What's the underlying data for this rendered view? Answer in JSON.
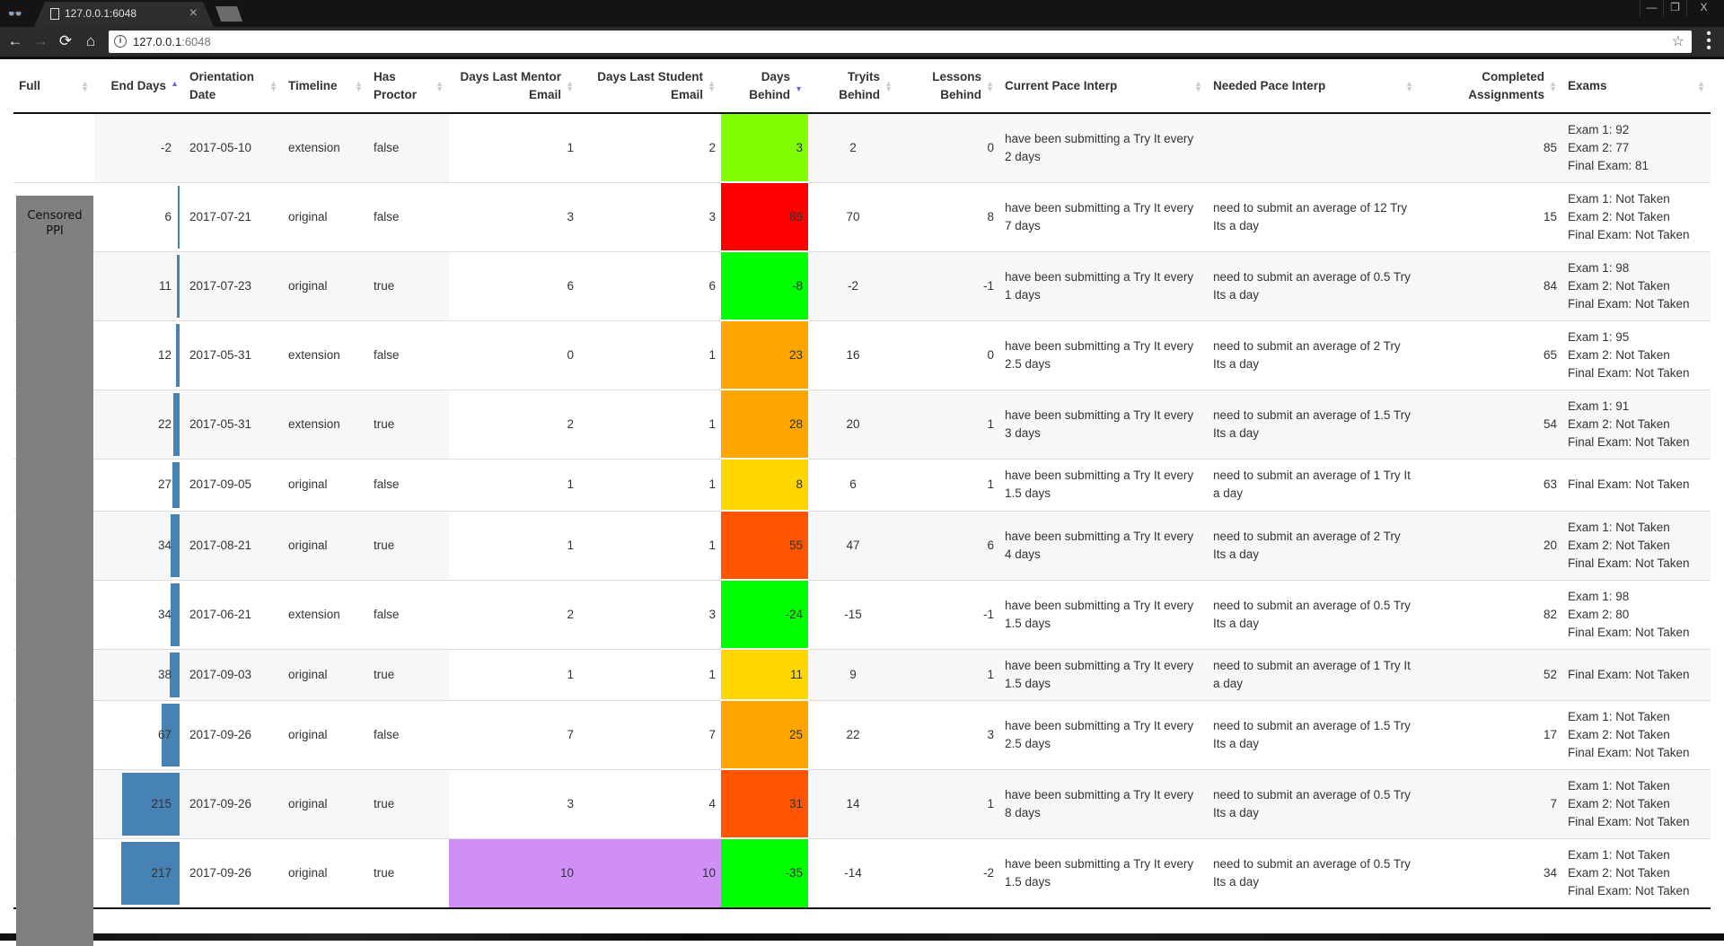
{
  "browser": {
    "tab_title": "127.0.0.1:6048",
    "url_host": "127.0.0.1",
    "url_port": ":6048",
    "icons": {
      "incognito": "incognito-icon",
      "page": "page-icon",
      "close": "×",
      "back": "←",
      "forward": "→",
      "reload": "⟳",
      "home": "⌂",
      "info": "i",
      "star": "☆",
      "menu": "⋮",
      "minimize": "—",
      "restore": "❐",
      "window_close": "X"
    }
  },
  "table": {
    "censored_label": "Censored PPI",
    "columns": [
      {
        "key": "full",
        "label": "Full",
        "sort": "none"
      },
      {
        "key": "end_days",
        "label": "End Days",
        "sort": "asc"
      },
      {
        "key": "orientation_date",
        "label": "Orientation Date",
        "sort": "none"
      },
      {
        "key": "timeline",
        "label": "Timeline",
        "sort": "none"
      },
      {
        "key": "has_proctor",
        "label": "Has Proctor",
        "sort": "none"
      },
      {
        "key": "days_last_mentor_email",
        "label": "Days Last Mentor Email",
        "sort": "none"
      },
      {
        "key": "days_last_student_email",
        "label": "Days Last Student Email",
        "sort": "none"
      },
      {
        "key": "days_behind",
        "label": "Days Behind",
        "sort": "desc"
      },
      {
        "key": "tryits_behind",
        "label": "Tryits Behind",
        "sort": "none"
      },
      {
        "key": "lessons_behind",
        "label": "Lessons Behind",
        "sort": "none"
      },
      {
        "key": "current_pace",
        "label": "Current Pace Interp",
        "sort": "none"
      },
      {
        "key": "needed_pace",
        "label": "Needed Pace Interp",
        "sort": "none"
      },
      {
        "key": "completed",
        "label": "Completed Assignments",
        "sort": "none"
      },
      {
        "key": "exams",
        "label": "Exams",
        "sort": "none"
      }
    ],
    "end_days_max": 217,
    "rows": [
      {
        "end_days": "-2",
        "orientation_date": "2017-05-10",
        "timeline": "extension",
        "has_proctor": "false",
        "mentor": "1",
        "student": "2",
        "days_behind": "3",
        "days_behind_color": "#80ff00",
        "tryits": "2",
        "lessons": "0",
        "current_pace": "have been submitting a Try It every 2 days",
        "needed_pace": "",
        "completed": "85",
        "exams": [
          "Exam 1: 92",
          "Exam 2: 77",
          "Final Exam: 81"
        ],
        "email_highlight": false
      },
      {
        "end_days": "6",
        "orientation_date": "2017-07-21",
        "timeline": "original",
        "has_proctor": "false",
        "mentor": "3",
        "student": "3",
        "days_behind": "89",
        "days_behind_color": "#ff0000",
        "tryits": "70",
        "lessons": "8",
        "current_pace": "have been submitting a Try It every 7 days",
        "needed_pace": "need to submit an average of 12 Try Its a day",
        "completed": "15",
        "exams": [
          "Exam 1: Not Taken",
          "Exam 2: Not Taken",
          "Final Exam: Not Taken"
        ],
        "email_highlight": false
      },
      {
        "end_days": "11",
        "orientation_date": "2017-07-23",
        "timeline": "original",
        "has_proctor": "true",
        "mentor": "6",
        "student": "6",
        "days_behind": "-8",
        "days_behind_color": "#00ff00",
        "tryits": "-2",
        "lessons": "-1",
        "current_pace": "have been submitting a Try It every 1 days",
        "needed_pace": "need to submit an average of 0.5 Try Its a day",
        "completed": "84",
        "exams": [
          "Exam 1: 98",
          "Exam 2: Not Taken",
          "Final Exam: Not Taken"
        ],
        "email_highlight": false
      },
      {
        "end_days": "12",
        "orientation_date": "2017-05-31",
        "timeline": "extension",
        "has_proctor": "false",
        "mentor": "0",
        "student": "1",
        "days_behind": "23",
        "days_behind_color": "#ffa500",
        "tryits": "16",
        "lessons": "0",
        "current_pace": "have been submitting a Try It every 2.5 days",
        "needed_pace": "need to submit an average of 2 Try Its a day",
        "completed": "65",
        "exams": [
          "Exam 1: 95",
          "Exam 2: Not Taken",
          "Final Exam: Not Taken"
        ],
        "email_highlight": false
      },
      {
        "end_days": "22",
        "orientation_date": "2017-05-31",
        "timeline": "extension",
        "has_proctor": "true",
        "mentor": "2",
        "student": "1",
        "days_behind": "28",
        "days_behind_color": "#ffa500",
        "tryits": "20",
        "lessons": "1",
        "current_pace": "have been submitting a Try It every 3 days",
        "needed_pace": "need to submit an average of 1.5 Try Its a day",
        "completed": "54",
        "exams": [
          "Exam 1: 91",
          "Exam 2: Not Taken",
          "Final Exam: Not Taken"
        ],
        "email_highlight": false
      },
      {
        "end_days": "27",
        "orientation_date": "2017-09-05",
        "timeline": "original",
        "has_proctor": "false",
        "mentor": "1",
        "student": "1",
        "days_behind": "8",
        "days_behind_color": "#ffd700",
        "tryits": "6",
        "lessons": "1",
        "current_pace": "have been submitting a Try It every 1.5 days",
        "needed_pace": "need to submit an average of 1 Try It a day",
        "completed": "63",
        "exams": [
          "Final Exam: Not Taken"
        ],
        "email_highlight": false
      },
      {
        "end_days": "34",
        "orientation_date": "2017-08-21",
        "timeline": "original",
        "has_proctor": "true",
        "mentor": "1",
        "student": "1",
        "days_behind": "55",
        "days_behind_color": "#ff5500",
        "tryits": "47",
        "lessons": "6",
        "current_pace": "have been submitting a Try It every 4 days",
        "needed_pace": "need to submit an average of 2 Try Its a day",
        "completed": "20",
        "exams": [
          "Exam 1: Not Taken",
          "Exam 2: Not Taken",
          "Final Exam: Not Taken"
        ],
        "email_highlight": false
      },
      {
        "end_days": "34",
        "orientation_date": "2017-06-21",
        "timeline": "extension",
        "has_proctor": "false",
        "mentor": "2",
        "student": "3",
        "days_behind": "-24",
        "days_behind_color": "#00ff00",
        "tryits": "-15",
        "lessons": "-1",
        "current_pace": "have been submitting a Try It every 1.5 days",
        "needed_pace": "need to submit an average of 0.5 Try Its a day",
        "completed": "82",
        "exams": [
          "Exam 1: 98",
          "Exam 2: 80",
          "Final Exam: Not Taken"
        ],
        "email_highlight": false
      },
      {
        "end_days": "38",
        "orientation_date": "2017-09-03",
        "timeline": "original",
        "has_proctor": "true",
        "mentor": "1",
        "student": "1",
        "days_behind": "11",
        "days_behind_color": "#ffd700",
        "tryits": "9",
        "lessons": "1",
        "current_pace": "have been submitting a Try It every 1.5 days",
        "needed_pace": "need to submit an average of 1 Try It a day",
        "completed": "52",
        "exams": [
          "Final Exam: Not Taken"
        ],
        "email_highlight": false
      },
      {
        "end_days": "67",
        "orientation_date": "2017-09-26",
        "timeline": "original",
        "has_proctor": "false",
        "mentor": "7",
        "student": "7",
        "days_behind": "25",
        "days_behind_color": "#ffa500",
        "tryits": "22",
        "lessons": "3",
        "current_pace": "have been submitting a Try It every 2.5 days",
        "needed_pace": "need to submit an average of 1.5 Try Its a day",
        "completed": "17",
        "exams": [
          "Exam 1: Not Taken",
          "Exam 2: Not Taken",
          "Final Exam: Not Taken"
        ],
        "email_highlight": false
      },
      {
        "end_days": "215",
        "orientation_date": "2017-09-26",
        "timeline": "original",
        "has_proctor": "true",
        "mentor": "3",
        "student": "4",
        "days_behind": "31",
        "days_behind_color": "#ff5500",
        "tryits": "14",
        "lessons": "1",
        "current_pace": "have been submitting a Try It every 8 days",
        "needed_pace": "need to submit an average of 0.5 Try Its a day",
        "completed": "7",
        "exams": [
          "Exam 1: Not Taken",
          "Exam 2: Not Taken",
          "Final Exam: Not Taken"
        ],
        "email_highlight": false
      },
      {
        "end_days": "217",
        "orientation_date": "2017-09-26",
        "timeline": "original",
        "has_proctor": "true",
        "mentor": "10",
        "student": "10",
        "days_behind": "-35",
        "days_behind_color": "#00ff00",
        "tryits": "-14",
        "lessons": "-2",
        "current_pace": "have been submitting a Try It every 1.5 days",
        "needed_pace": "need to submit an average of 0.5 Try Its a day",
        "completed": "34",
        "exams": [
          "Exam 1: Not Taken",
          "Exam 2: Not Taken",
          "Final Exam: Not Taken"
        ],
        "email_highlight": true
      }
    ]
  },
  "colors": {
    "bar": "#4682b4",
    "email_highlight": "#cf8ff7",
    "sort_active": "#6a6ad8"
  }
}
